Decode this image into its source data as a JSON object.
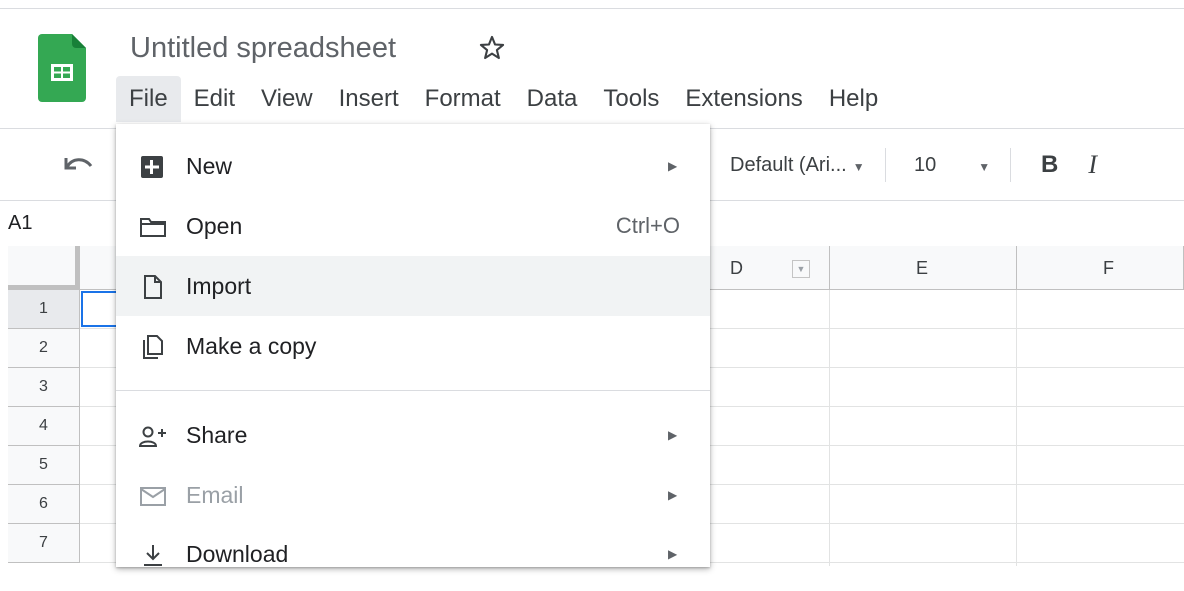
{
  "doc": {
    "title": "Untitled spreadsheet"
  },
  "menubar": [
    "File",
    "Edit",
    "View",
    "Insert",
    "Format",
    "Data",
    "Tools",
    "Extensions",
    "Help"
  ],
  "toolbar": {
    "font": "Default (Ari...",
    "size": "10",
    "bold": "B",
    "italic": "I"
  },
  "name_box": "A1",
  "columns": [
    "D",
    "E",
    "F"
  ],
  "rows": [
    "1",
    "2",
    "3",
    "4",
    "5",
    "6",
    "7"
  ],
  "file_menu": {
    "items": [
      {
        "label": "New",
        "icon": "new-spreadsheet-icon",
        "submenu": true
      },
      {
        "label": "Open",
        "icon": "folder-icon",
        "shortcut": "Ctrl+O"
      },
      {
        "label": "Import",
        "icon": "file-icon",
        "highlighted": true
      },
      {
        "label": "Make a copy",
        "icon": "copy-icon"
      },
      {
        "label": "Share",
        "icon": "share-person-icon",
        "submenu": true
      },
      {
        "label": "Email",
        "icon": "email-icon",
        "submenu": true,
        "disabled": true
      },
      {
        "label": "Download",
        "icon": "download-icon",
        "submenu": true
      }
    ]
  },
  "colors": {
    "sheets_green": "#188038",
    "selection_blue": "#1a73e8",
    "hover_gray": "#f1f3f4"
  }
}
